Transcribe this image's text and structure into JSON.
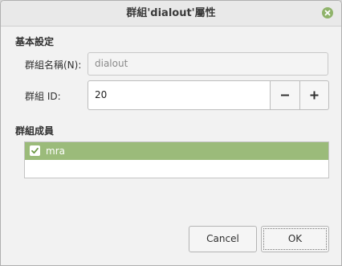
{
  "window": {
    "title": "群組'dialout'屬性",
    "close_icon": "close-icon"
  },
  "basic_settings": {
    "heading": "基本設定",
    "group_name_label": "群組名稱(N):",
    "group_name_value": "dialout",
    "group_id_label": "群組 ID:",
    "group_id_value": "20",
    "decrement_label": "−",
    "increment_label": "+"
  },
  "members": {
    "heading": "群組成員",
    "items": [
      {
        "name": "mra",
        "checked": true
      }
    ]
  },
  "buttons": {
    "cancel_label": "Cancel",
    "ok_label": "OK"
  },
  "colors": {
    "accent": "#9bbb7a",
    "close_button": "#8fb36a"
  }
}
